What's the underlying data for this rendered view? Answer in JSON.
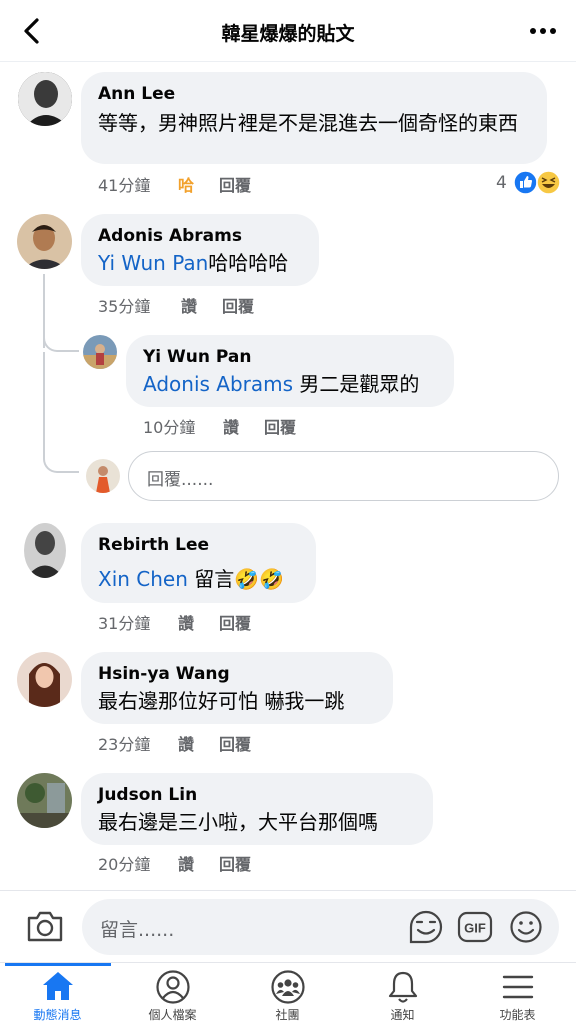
{
  "header": {
    "title": "韓星爆爆的貼文"
  },
  "comments": [
    {
      "name": "Ann Lee",
      "text": "等等，男神照片裡是不是混進去一個奇怪的東西",
      "time": "41分鐘",
      "like": "哈",
      "reply": "回覆",
      "reaction_count": "4"
    },
    {
      "name": "Adonis Abrams",
      "mention": "Yi Wun Pan",
      "text": "哈哈哈哈",
      "time": "35分鐘",
      "like": "讚",
      "reply": "回覆"
    },
    {
      "name": "Yi Wun Pan",
      "mention": "Adonis Abrams",
      "text": " 男二是觀眾的",
      "time": "10分鐘",
      "like": "讚",
      "reply": "回覆"
    },
    {
      "name": "Rebirth Lee",
      "mention": "Xin Chen",
      "text": " 留言🤣🤣",
      "time": "31分鐘",
      "like": "讚",
      "reply": "回覆"
    },
    {
      "name": "Hsin-ya Wang",
      "text": "最右邊那位好可怕 嚇我一跳",
      "time": "23分鐘",
      "like": "讚",
      "reply": "回覆"
    },
    {
      "name": "Judson Lin",
      "text": "最右邊是三小啦，大平台那個嗎",
      "time": "20分鐘",
      "like": "讚",
      "reply": "回覆"
    }
  ],
  "reply_input": {
    "placeholder": "回覆......"
  },
  "composer": {
    "placeholder": "留言......"
  },
  "tabs": [
    {
      "label": "動態消息",
      "icon": "home-icon",
      "active": true
    },
    {
      "label": "個人檔案",
      "icon": "profile-icon"
    },
    {
      "label": "社團",
      "icon": "groups-icon"
    },
    {
      "label": "通知",
      "icon": "bell-icon"
    },
    {
      "label": "功能表",
      "icon": "menu-icon"
    }
  ],
  "colors": {
    "accent": "#1877f2",
    "mention": "#1464c7",
    "haha": "#f2a12c",
    "bubble": "#f0f2f5"
  }
}
